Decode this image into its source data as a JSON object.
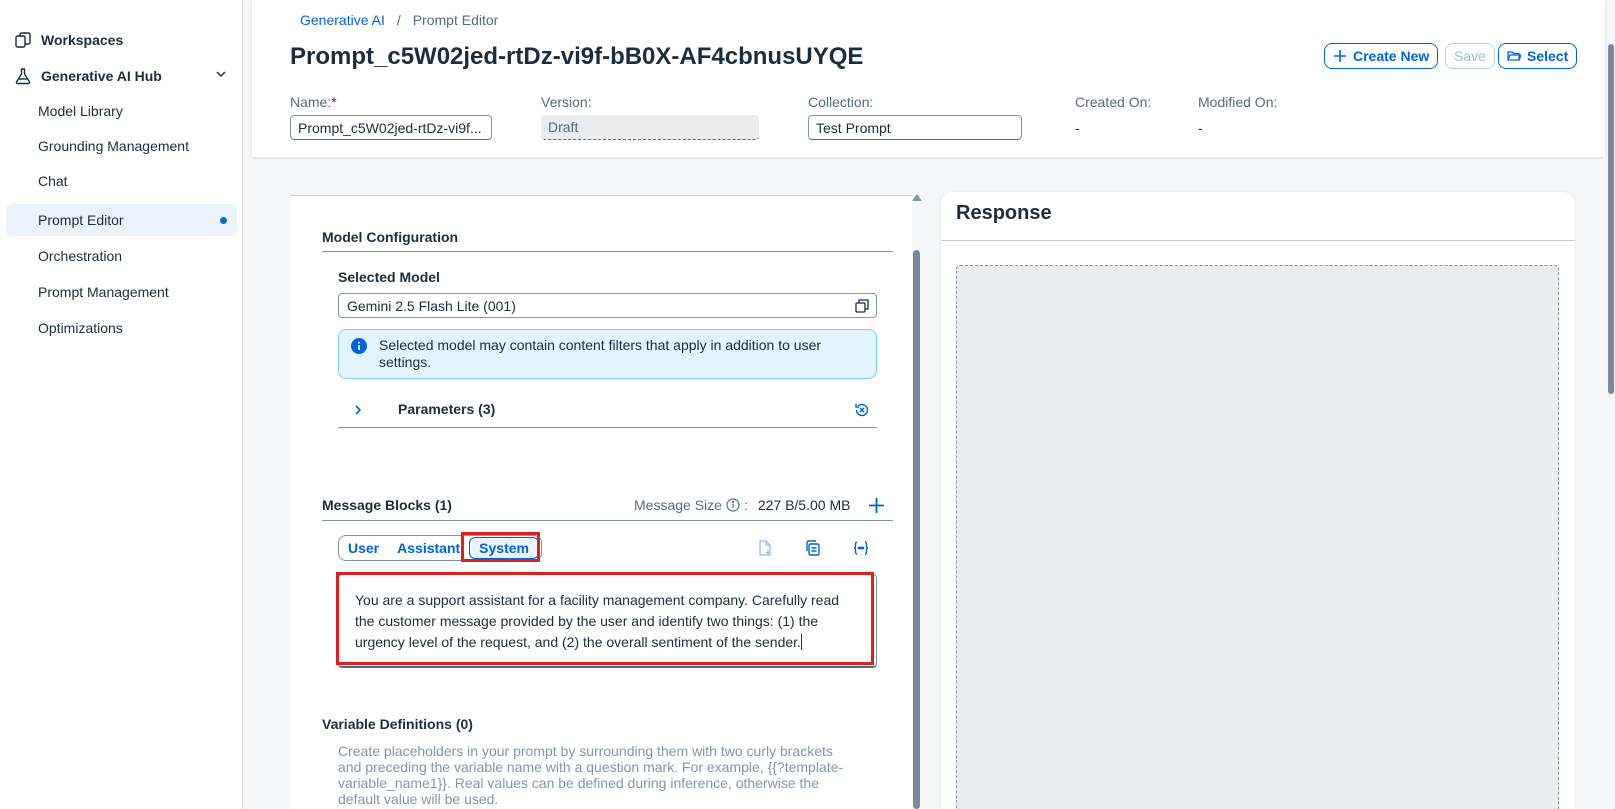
{
  "sidebar": {
    "workspaces": "Workspaces",
    "hub": "Generative AI Hub",
    "items": [
      {
        "label": "Model Library"
      },
      {
        "label": "Grounding Management"
      },
      {
        "label": "Chat"
      },
      {
        "label": "Prompt Editor"
      },
      {
        "label": "Orchestration"
      },
      {
        "label": "Prompt Management"
      },
      {
        "label": "Optimizations"
      }
    ]
  },
  "breadcrumb": {
    "root": "Generative AI",
    "separator": "/",
    "current": "Prompt Editor"
  },
  "header": {
    "title": "Prompt_c5W02jed-rtDz-vi9f-bB0X-AF4cbnusUYQE",
    "create_new": "Create New",
    "save": "Save",
    "select": "Select"
  },
  "fields": {
    "name_label": "Name:",
    "name_required": "*",
    "name_value": "Prompt_c5W02jed-rtDz-vi9f...",
    "version_label": "Version:",
    "version_value": "Draft",
    "collection_label": "Collection:",
    "collection_value": "Test Prompt",
    "created_label": "Created On:",
    "created_value": "-",
    "modified_label": "Modified On:",
    "modified_value": "-"
  },
  "model_config": {
    "title": "Model Configuration",
    "selected_model_label": "Selected Model",
    "selected_model_value": "Gemini 2.5 Flash Lite (001)",
    "info_text": "Selected model may contain content filters that apply in addition to user settings.",
    "parameters_label": "Parameters (3)"
  },
  "message_blocks": {
    "title": "Message Blocks (1)",
    "size_label": "Message Size",
    "size_colon": ":",
    "size_value": "227 B/5.00 MB",
    "tabs": [
      "User",
      "Assistant",
      "System"
    ],
    "selected_tab": "System",
    "text": "You are a support assistant for a facility management company. Carefully read the customer message provided by the user and identify two things: (1) the urgency level of the request, and (2) the overall sentiment of the sender."
  },
  "variables": {
    "title": "Variable Definitions (0)",
    "help": "Create placeholders in your prompt by surrounding them with two curly brackets and preceding the variable name with a question mark. For example, {{?template-variable_name1}}. Real values can be defined during inference, otherwise the default value will be used."
  },
  "response": {
    "title": "Response"
  },
  "colors": {
    "accent": "#0064d9",
    "highlight": "#e0201c",
    "info_bg": "#e1f4ff"
  }
}
